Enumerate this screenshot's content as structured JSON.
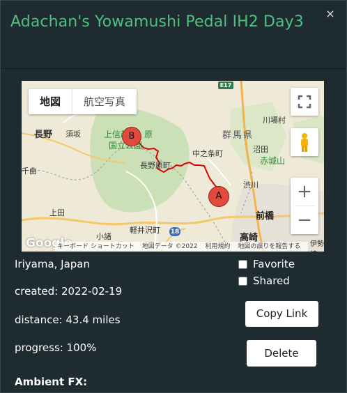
{
  "modal": {
    "title": "Adachan's Yowamushi Pedal IH2 Day3",
    "close_glyph": "×"
  },
  "map": {
    "map_type_buttons": [
      "地図",
      "航空写真"
    ],
    "labels": {
      "nagano": "長野",
      "suzaka": "須坂",
      "kamishinetsu": "上信越",
      "kogen": "原",
      "kokuritsu": "国立公園",
      "nakanojo": "中之条町",
      "naganoharamachi": "長野原町",
      "gunma": "群馬県",
      "kawaba": "川場村",
      "numata": "沼田",
      "akagi": "赤城山",
      "shibukawa": "渋川",
      "maebashi": "前橋",
      "takasaki": "高崎",
      "ueda": "上田",
      "komoro": "小諸",
      "karuizawa": "軽井沢町",
      "chiku": "千曲",
      "isesaki": "伊勢崎",
      "route_e17": "E17",
      "route_18": "18"
    },
    "markers": {
      "start": "A",
      "end": "B"
    },
    "attribution": [
      "キーボード ショートカット",
      "地図データ ©2022",
      "利用規約",
      "地図の誤りを報告する"
    ],
    "logo": "Google",
    "zoom_in": "+",
    "zoom_out": "−"
  },
  "details": {
    "location": "Iriyama, Japan",
    "created": "created: 2022-02-19",
    "distance": "distance: 43.4 miles",
    "progress": "progress: 100%",
    "ambient": "Ambient FX:"
  },
  "options": {
    "favorite_label": "Favorite",
    "shared_label": "Shared",
    "copy_link_label": "Copy Link",
    "delete_label": "Delete"
  },
  "colors": {
    "title": "#4fc07f",
    "background": "#1e2b30",
    "route": "#e00000",
    "marker": "#e24b3c"
  }
}
